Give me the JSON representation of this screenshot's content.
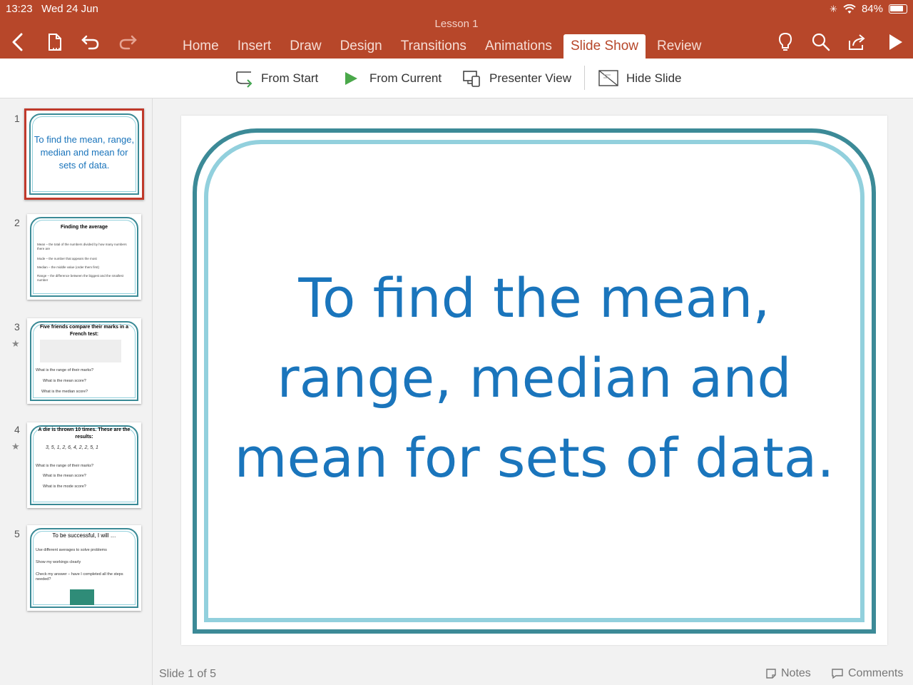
{
  "status": {
    "time": "13:23",
    "date": "Wed 24 Jun",
    "battery": "84%"
  },
  "document": {
    "title": "Lesson 1"
  },
  "tabs": [
    {
      "label": "Home"
    },
    {
      "label": "Insert"
    },
    {
      "label": "Draw"
    },
    {
      "label": "Design"
    },
    {
      "label": "Transitions"
    },
    {
      "label": "Animations"
    },
    {
      "label": "Slide Show",
      "active": true
    },
    {
      "label": "Review"
    }
  ],
  "ribbon": {
    "from_start": "From Start",
    "from_current": "From Current",
    "presenter_view": "Presenter View",
    "hide_slide": "Hide Slide"
  },
  "thumbnails": [
    {
      "number": "1",
      "title": "To find the mean, range, median and mean for sets of data."
    },
    {
      "number": "2",
      "heading": "Finding the average",
      "lines": [
        "Mean – the total of the numbers divided by how many numbers there are",
        "Mode – the number that appears the most",
        "Median – the middle value (order them first)",
        "Range – the difference between the biggest and the smallest number"
      ]
    },
    {
      "number": "3",
      "heading": "Five friends compare their marks in a French test:",
      "lines": [
        "What is the range of their marks?",
        "What is the mean score?",
        "What is the median score?"
      ]
    },
    {
      "number": "4",
      "heading": "A die is thrown 10 times. These are the results:",
      "data": "3, 5, 1, 2, 6, 4, 2, 2, 5, 1",
      "lines": [
        "What is the range of their marks?",
        "What is the mean score?",
        "What is the mode score?"
      ]
    },
    {
      "number": "5",
      "heading": "To be successful, I will …",
      "lines": [
        "Use different averages to solve problems",
        "Show my workings clearly",
        "Check my answer – have I completed all the steps needed?"
      ]
    }
  ],
  "slide": {
    "title_line1": "To find the mean,",
    "title_line2": "range, median and",
    "title_line3": "mean for sets of data."
  },
  "footer": {
    "slide_count": "Slide 1 of 5",
    "notes": "Notes",
    "comments": "Comments"
  },
  "colors": {
    "accent": "#b7472a",
    "slide_text": "#1a75bc",
    "frame_outer": "#3c8a97",
    "frame_inner": "#92d0dd"
  }
}
